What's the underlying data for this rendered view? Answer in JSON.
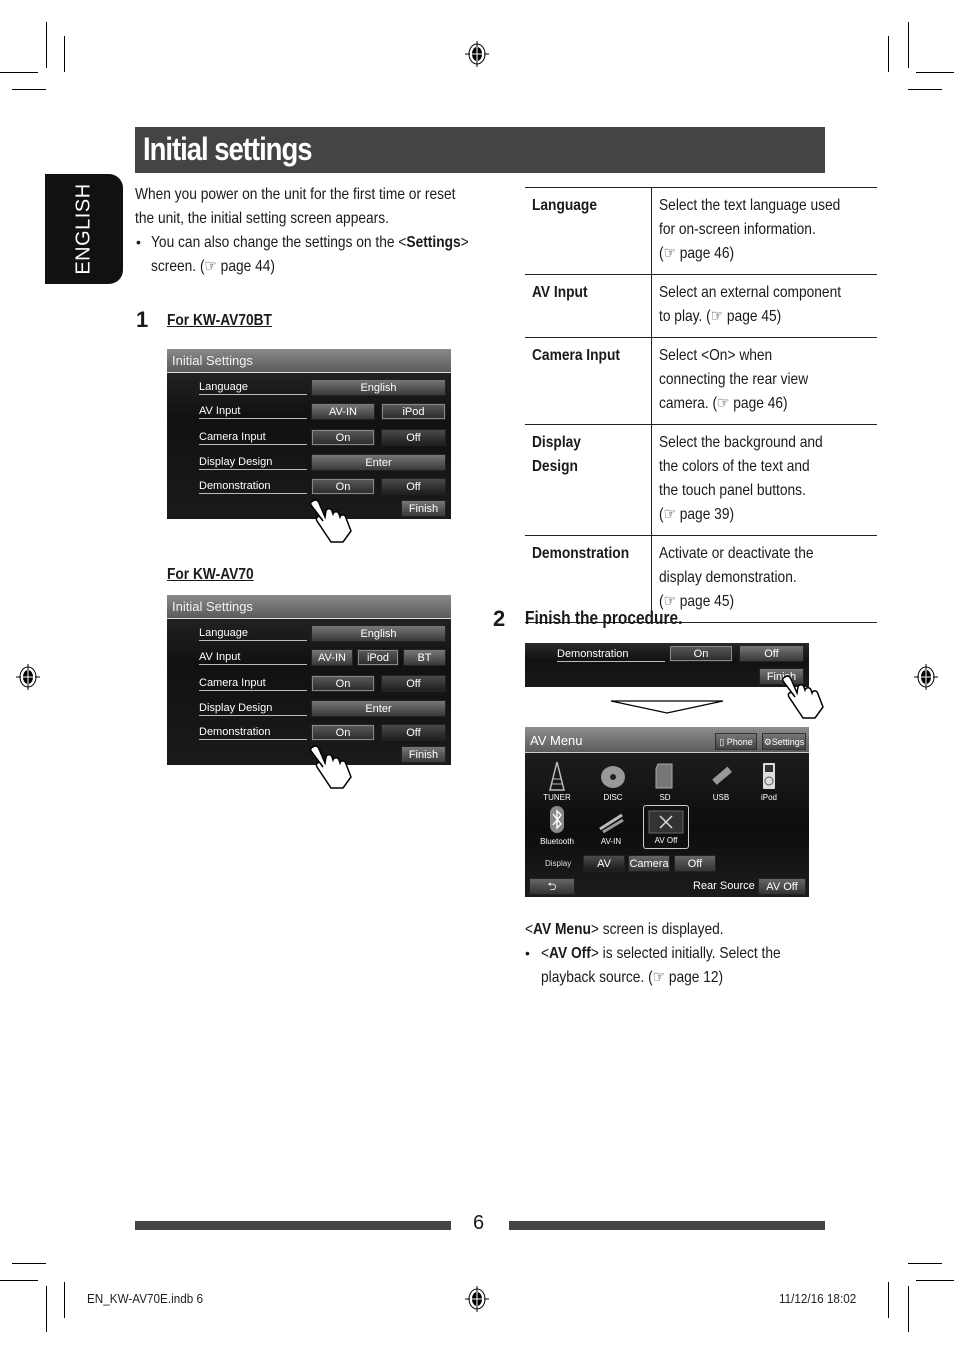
{
  "title": "Initial settings",
  "language_tab": "ENGLISH",
  "intro": {
    "line1": "When you power on the unit for the first time or reset",
    "line2": "the unit, the initial setting screen appears.",
    "bullet_line1_pre": "You can also change the settings on the <",
    "bullet_line1_bold": "Settings",
    "bullet_line1_post": ">",
    "bullet_line2": "screen. (☞ page 44)",
    "bullet_symbol": "•"
  },
  "step1": {
    "number": "1",
    "models": [
      {
        "label": "For KW-AV70BT",
        "screen": {
          "title": "Initial Settings",
          "rows": [
            {
              "label": "Language",
              "buttons": [
                "English"
              ],
              "selected": []
            },
            {
              "label": "AV Input",
              "buttons": [
                "AV-IN",
                "iPod"
              ],
              "selected": [
                "iPod"
              ]
            },
            {
              "label": "Camera Input",
              "buttons": [
                "On",
                "Off"
              ],
              "selected": [
                "On"
              ]
            },
            {
              "label": "Display Design",
              "buttons": [
                "Enter"
              ],
              "selected": []
            },
            {
              "label": "Demonstration",
              "buttons": [
                "On",
                "Off"
              ],
              "selected": [
                "On"
              ]
            }
          ],
          "finish": "Finish"
        }
      },
      {
        "label": "For KW-AV70",
        "screen": {
          "title": "Initial Settings",
          "rows": [
            {
              "label": "Language",
              "buttons": [
                "English"
              ],
              "selected": []
            },
            {
              "label": "AV Input",
              "buttons": [
                "AV-IN",
                "iPod",
                "BT"
              ],
              "selected": [
                "iPod"
              ]
            },
            {
              "label": "Camera Input",
              "buttons": [
                "On",
                "Off"
              ],
              "selected": [
                "On"
              ]
            },
            {
              "label": "Display Design",
              "buttons": [
                "Enter"
              ],
              "selected": []
            },
            {
              "label": "Demonstration",
              "buttons": [
                "On",
                "Off"
              ],
              "selected": [
                "On"
              ]
            }
          ],
          "finish": "Finish"
        }
      }
    ]
  },
  "settings_table": [
    {
      "key": "Language",
      "lines": [
        "Select the text language used",
        "for on-screen information.",
        "(☞ page 46)"
      ]
    },
    {
      "key": "AV Input",
      "lines": [
        "Select an external component",
        "to play. (☞ page 45)"
      ]
    },
    {
      "key": "Camera Input",
      "lines": [
        "Select <On> when",
        "connecting the rear view",
        "camera. (☞ page 46)"
      ]
    },
    {
      "key_lines": [
        "Display",
        "Design"
      ],
      "key": "Display Design",
      "lines": [
        "Select the background and",
        "the colors of the text and",
        "the touch panel buttons.",
        "(☞ page 39)"
      ]
    },
    {
      "key": "Demonstration",
      "lines": [
        "Activate or deactivate the",
        "display demonstration.",
        "(☞ page 45)"
      ]
    }
  ],
  "step2": {
    "number": "2",
    "label": "Finish the procedure.",
    "partial_screen": {
      "row_label": "Demonstration",
      "on": "On",
      "off": "Off",
      "finish": "Finish"
    },
    "av_menu": {
      "title": "AV Menu",
      "phone": "Phone",
      "settings": "Settings",
      "sources": [
        "TUNER",
        "DISC",
        "SD",
        "USB",
        "iPod",
        "Bluetooth",
        "AV-IN",
        "AV Off"
      ],
      "selected_source": "AV Off",
      "display_label": "Display",
      "display_options": [
        "AV",
        "Camera",
        "Off"
      ],
      "display_selected": "AV",
      "back": "⮌",
      "rear_source_label": "Rear Source",
      "rear_source_value": "AV Off"
    },
    "result_line_pre": "<",
    "result_line_bold": "AV Menu",
    "result_line_post": "> screen is displayed.",
    "bullet_pre": "<",
    "bullet_bold": "AV Off",
    "bullet_post": "> is selected initially. Select the",
    "bullet_line2": "playback source. (☞ page 12)"
  },
  "footer": {
    "page_number": "6",
    "file": "EN_KW-AV70E.indb   6",
    "datetime": "11/12/16   18:02"
  }
}
